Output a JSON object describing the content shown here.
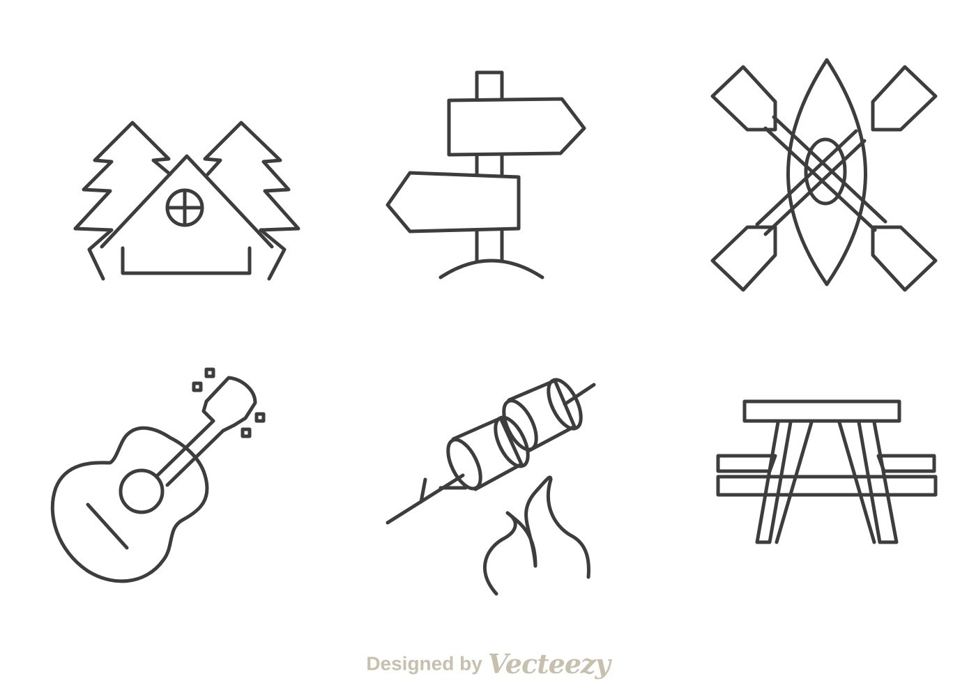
{
  "colors": {
    "stroke": "#3d3d3d",
    "background": "#ffffff",
    "credit_text": "#c8c0ae"
  },
  "icons": [
    {
      "name": "cabin-with-pine-trees-icon"
    },
    {
      "name": "directional-signpost-icon"
    },
    {
      "name": "kayak-with-crossed-paddles-icon"
    },
    {
      "name": "acoustic-guitar-icon"
    },
    {
      "name": "roasting-marshmallows-over-fire-icon"
    },
    {
      "name": "picnic-table-icon"
    }
  ],
  "footer": {
    "prefix": "Designed by",
    "brand": "Vecteezy"
  }
}
